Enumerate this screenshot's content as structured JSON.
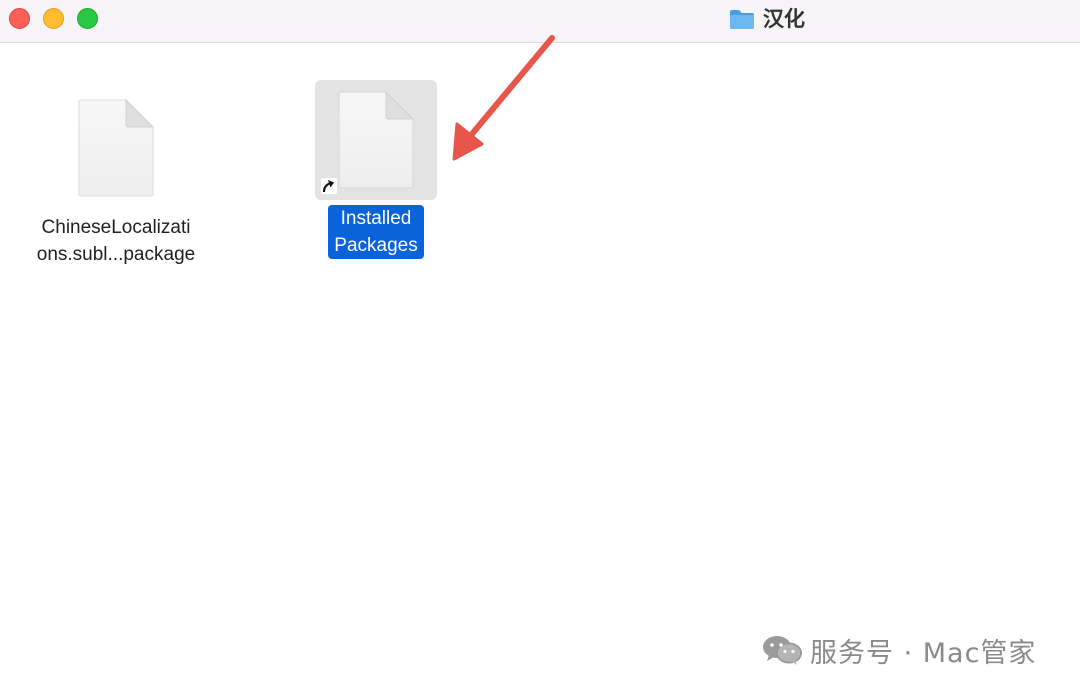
{
  "window": {
    "title": "汉化",
    "title_icon": "folder-icon"
  },
  "files": [
    {
      "name_line1": "ChineseLocalizati",
      "name_line2": "ons.subl...package",
      "icon": "document-icon",
      "selected": false
    },
    {
      "name_line1": "Installed",
      "name_line2": "Packages",
      "icon": "alias-document-icon",
      "selected": true
    }
  ],
  "annotation": {
    "color": "#e8554a",
    "points_to": "Installed Packages"
  },
  "watermark": {
    "text": "服务号 · Mac管家",
    "icon": "wechat-icon"
  },
  "colors": {
    "selection": "#0b63d9",
    "close": "#fe5f57",
    "minimize": "#febc2e",
    "zoom": "#28c840",
    "folder": "#5aaeea"
  }
}
